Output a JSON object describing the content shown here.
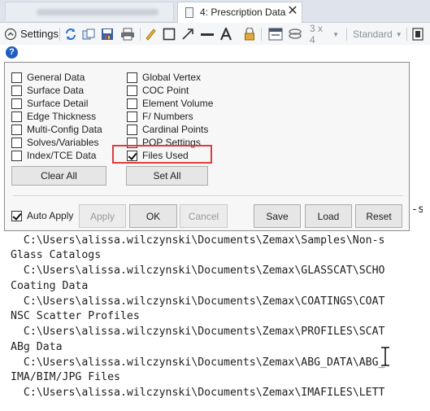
{
  "tabs": {
    "active_label": "4: Prescription Data",
    "close_glyph": "✕"
  },
  "toolbar": {
    "settings_label": "Settings",
    "layout_label": "3 x 4",
    "standard_label": "Standard"
  },
  "panel": {
    "left_checks": [
      {
        "label": "General Data",
        "checked": false
      },
      {
        "label": "Surface Data",
        "checked": false
      },
      {
        "label": "Surface Detail",
        "checked": false
      },
      {
        "label": "Edge Thickness",
        "checked": false
      },
      {
        "label": "Multi-Config Data",
        "checked": false
      },
      {
        "label": "Solves/Variables",
        "checked": false
      },
      {
        "label": "Index/TCE Data",
        "checked": false
      }
    ],
    "right_checks": [
      {
        "label": "Global Vertex",
        "checked": false
      },
      {
        "label": "COC Point",
        "checked": false
      },
      {
        "label": "Element Volume",
        "checked": false
      },
      {
        "label": "F/ Numbers",
        "checked": false
      },
      {
        "label": "Cardinal Points",
        "checked": false
      },
      {
        "label": "POP Settings",
        "checked": false
      },
      {
        "label": "Files Used",
        "checked": true
      }
    ],
    "clear_all_label": "Clear All",
    "set_all_label": "Set All",
    "auto_apply_label": "Auto Apply",
    "auto_apply_checked": true,
    "apply_label": "Apply",
    "ok_label": "OK",
    "cancel_label": "Cancel",
    "save_label": "Save",
    "load_label": "Load",
    "reset_label": "Reset"
  },
  "output": {
    "behind_fragment": "-s",
    "lines": [
      "  C:\\Users\\alissa.wilczynski\\Documents\\Zemax\\Samples\\Non-s",
      "Glass Catalogs",
      "  C:\\Users\\alissa.wilczynski\\Documents\\Zemax\\GLASSCAT\\SCHO",
      "Coating Data",
      "  C:\\Users\\alissa.wilczynski\\Documents\\Zemax\\COATINGS\\COAT",
      "NSC Scatter Profiles",
      "  C:\\Users\\alissa.wilczynski\\Documents\\Zemax\\PROFILES\\SCAT",
      "ABg Data",
      "  C:\\Users\\alissa.wilczynski\\Documents\\Zemax\\ABG_DATA\\ABG_",
      "IMA/BIM/JPG Files",
      "  C:\\Users\\alissa.wilczynski\\Documents\\Zemax\\IMAFILES\\LETT"
    ]
  },
  "colors": {
    "highlight": "#e23b3b",
    "help_icon": "#1f5fbf",
    "tabstrip": "#dfe4ec"
  }
}
